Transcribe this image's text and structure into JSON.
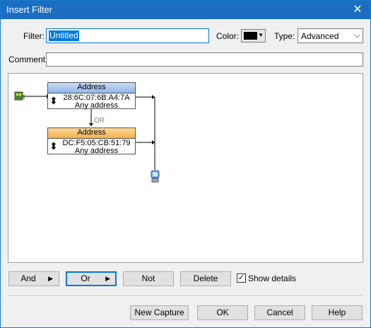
{
  "window": {
    "title": "Insert Filter",
    "close_glyph": "✕"
  },
  "form": {
    "filter_label": "Filter:",
    "filter_value": "Untitled",
    "color_label": "Color:",
    "color_value": "#000000",
    "type_label": "Type:",
    "type_value": "Advanced",
    "comment_label": "Comment:",
    "comment_value": ""
  },
  "diagram": {
    "nodes": [
      {
        "header": "Address",
        "mac": "28:6C:07:6B:A4:7A",
        "target": "Any address",
        "header_color": "#a9c7ef"
      },
      {
        "header": "Address",
        "mac": "DC:F5:05:CB:51:79",
        "target": "Any address",
        "header_color": "#f6c06a"
      }
    ],
    "or_label": "OR",
    "input_icon": "network-adapter-icon",
    "output_icon": "computer-icon"
  },
  "actions": {
    "and": "And",
    "or": "Or",
    "not": "Not",
    "delete": "Delete",
    "show_details": "Show details",
    "show_details_checked": true
  },
  "footer": {
    "new_capture": "New Capture",
    "ok": "OK",
    "cancel": "Cancel",
    "help": "Help"
  }
}
